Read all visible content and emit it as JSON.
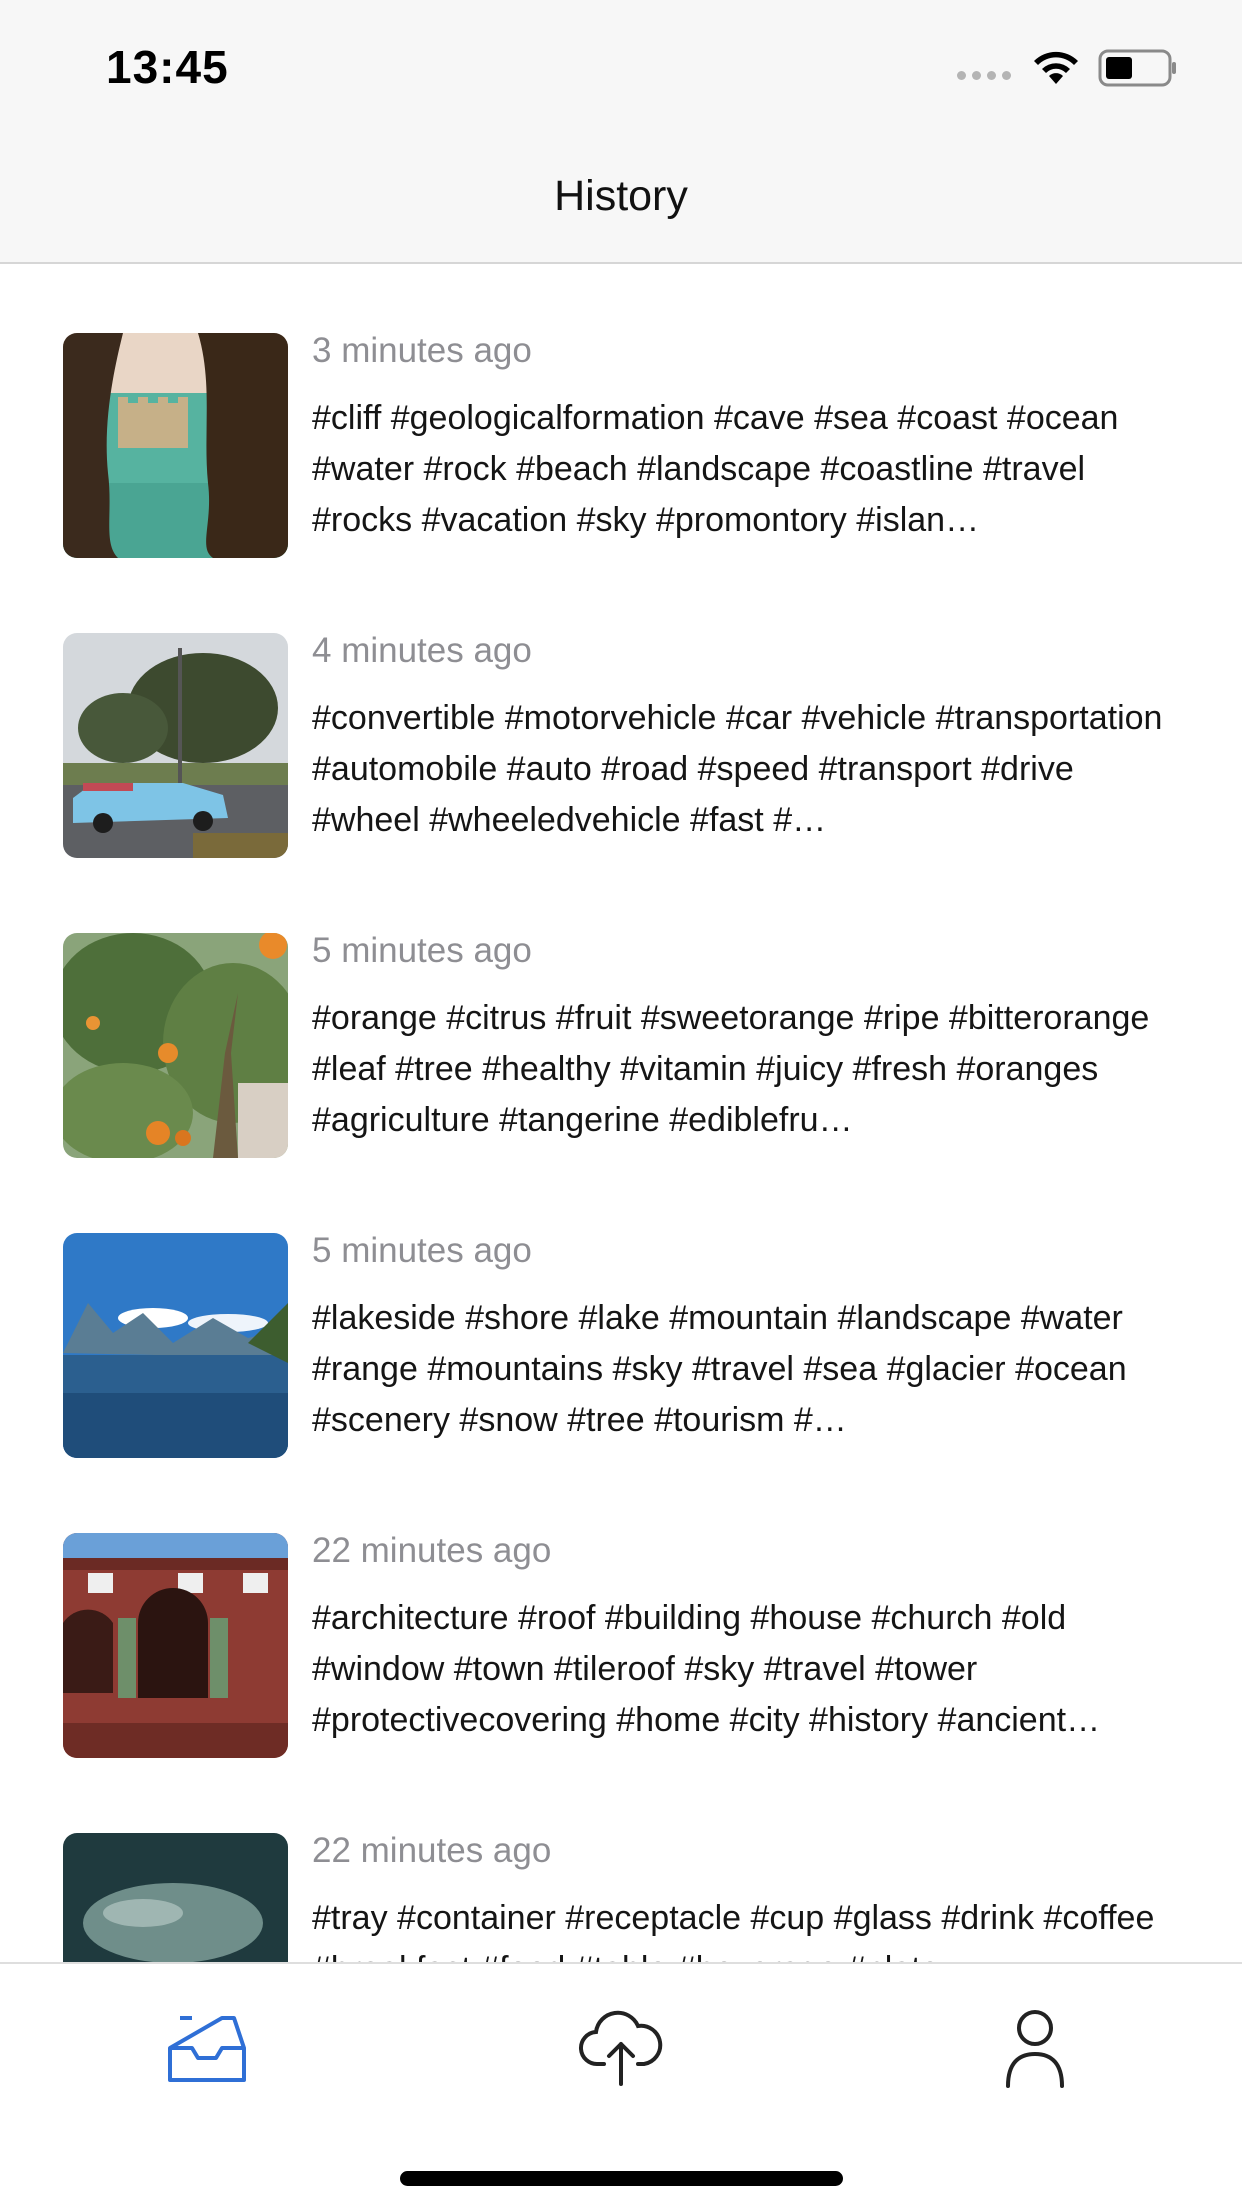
{
  "status_bar": {
    "time": "13:45"
  },
  "nav": {
    "title": "History"
  },
  "history": [
    {
      "time_ago": "3 minutes ago",
      "tags": "#cliff #geologicalformation #cave #sea #coast #ocean #water #rock #beach #landscape #coastline #travel #rocks #vacation #sky #promontory #islan…",
      "thumb_subject": "sea-cave-castle"
    },
    {
      "time_ago": "4 minutes ago",
      "tags": "#convertible #motorvehicle #car #vehicle #transportation #automobile #auto #road #speed #transport #drive #wheel #wheeledvehicle #fast #…",
      "thumb_subject": "blue-convertible-car"
    },
    {
      "time_ago": "5 minutes ago",
      "tags": "#orange #citrus #fruit #sweetorange #ripe #bitterorange #leaf #tree #healthy #vitamin #juicy #fresh #oranges #agriculture #tangerine #ediblefru…",
      "thumb_subject": "orange-tree"
    },
    {
      "time_ago": "5 minutes ago",
      "tags": "#lakeside #shore #lake #mountain #landscape #water #range #mountains #sky #travel #sea #glacier #ocean #scenery #snow #tree #tourism #…",
      "thumb_subject": "mountain-lake"
    },
    {
      "time_ago": "22 minutes ago",
      "tags": "#architecture #roof #building #house #church #old #window #town #tileroof #sky #travel #tower #protectivecovering #home #city #history #ancient…",
      "thumb_subject": "red-building"
    },
    {
      "time_ago": "22 minutes ago",
      "tags": "#tray #container #receptacle #cup #glass #drink #coffee #breakfast #food #table #beverage #plate…",
      "thumb_subject": "dark-water"
    }
  ],
  "tabbar": {
    "active_color": "#2f6fd6",
    "inactive_color": "#222222",
    "tabs": [
      {
        "icon": "inbox-icon",
        "active": true
      },
      {
        "icon": "cloud-upload-icon",
        "active": false
      },
      {
        "icon": "person-icon",
        "active": false
      }
    ]
  }
}
